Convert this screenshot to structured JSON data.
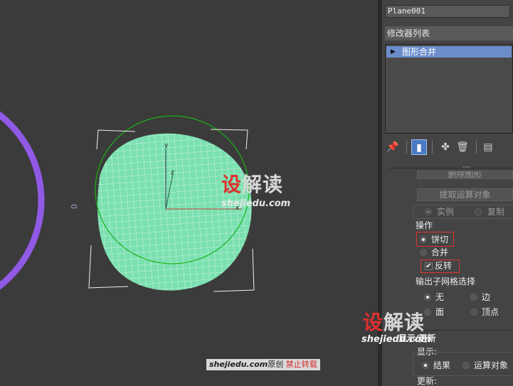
{
  "panel": {
    "object_name": "Plane001",
    "modifier_list_label": "修改器列表",
    "stack_item_label": "图形合并"
  },
  "parameters": {
    "remove_shape_label": "删除图形",
    "extract_operand_label": "提取运算对象",
    "extract_mode": {
      "instance_label": "实例",
      "copy_label": "复制",
      "selected": "instance"
    },
    "operation": {
      "title": "操作",
      "cookie_cutter_label": "饼切",
      "merge_label": "合并",
      "reverse_label": "反转",
      "selected": "cookie_cutter",
      "reverse_checked": true
    },
    "output_submesh": {
      "title": "输出子网格选择",
      "none_label": "无",
      "edge_label": "边",
      "face_label": "面",
      "vertex_label": "顶点",
      "selected": "none"
    },
    "display_update": {
      "title": "显示/更新",
      "display_label": "显示:",
      "result_label": "结果",
      "operand_label": "运算对象",
      "update_label": "更新:",
      "selected": "result"
    }
  },
  "viewport": {
    "axis_x": "x",
    "axis_y": "y",
    "axis_z": "z",
    "side_glyph": "0",
    "mesh_fill_color": "#7be0b0",
    "circle_color": "#19b319",
    "ring_color": "#9059e6"
  },
  "watermark": {
    "brand_red": "设",
    "brand_rest": "解读",
    "site": "shejiedu.com",
    "credit_site": "shejiedu.com",
    "credit_original": "原创",
    "credit_warning": "禁止转载"
  }
}
